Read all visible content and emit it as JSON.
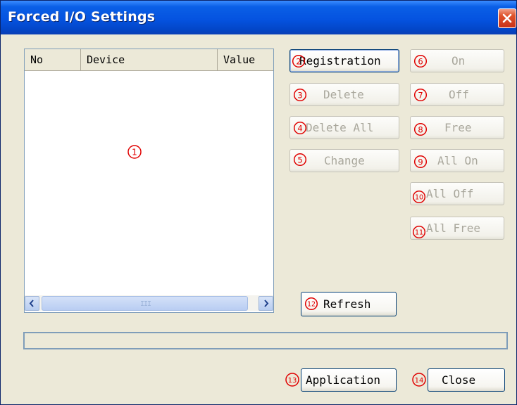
{
  "window": {
    "title": "Forced I/O Settings",
    "close_icon": "close-x-icon"
  },
  "device_list": {
    "columns": [
      "No",
      "Device",
      "Value"
    ],
    "rows": [],
    "marker": "①"
  },
  "buttons": {
    "registration": {
      "label": "Registration",
      "marker": "②"
    },
    "delete": {
      "label": "Delete",
      "marker": "③"
    },
    "delete_all": {
      "label": "Delete All",
      "marker": "④"
    },
    "change": {
      "label": "Change",
      "marker": "⑤"
    },
    "on": {
      "label": "On",
      "marker": "⑥"
    },
    "off": {
      "label": "Off",
      "marker": "⑦"
    },
    "free": {
      "label": "Free",
      "marker": "⑧"
    },
    "all_on": {
      "label": "All On",
      "marker": "⑨"
    },
    "all_off": {
      "label": "All Off",
      "marker": "⑩"
    },
    "all_free": {
      "label": "All Free",
      "marker": "⑪"
    },
    "refresh": {
      "label": "Refresh",
      "marker": "⑫"
    },
    "application": {
      "label": "Application",
      "marker": "⑬"
    },
    "close": {
      "label": "Close",
      "marker": "⑭"
    }
  },
  "scrollbar": {
    "left_icon": "chevron-left-icon",
    "right_icon": "chevron-right-icon",
    "grip": "III"
  },
  "colors": {
    "marker_red": "#e00000",
    "title_blue": "#0553e0"
  }
}
